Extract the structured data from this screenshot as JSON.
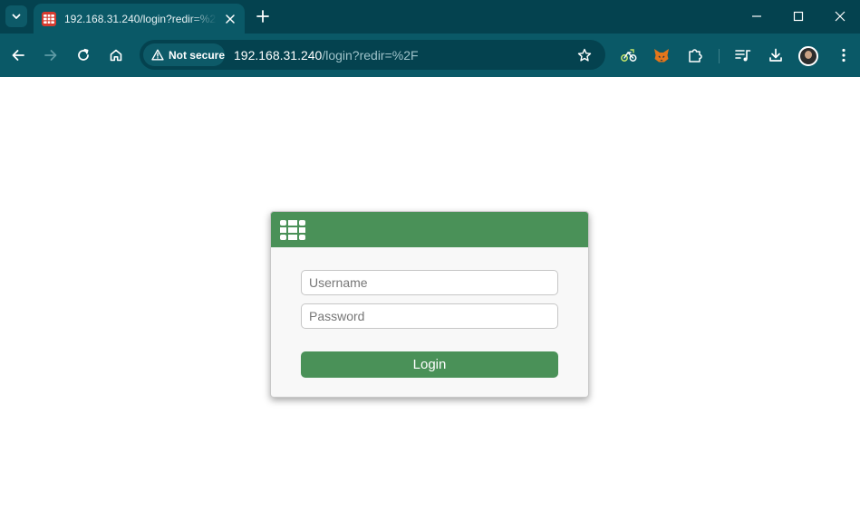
{
  "browser": {
    "tab": {
      "title": "192.168.31.240/login?redir=%2F",
      "favicon": "fortinet-favicon"
    },
    "address_bar": {
      "security_label": "Not secure",
      "url_host": "192.168.31.240",
      "url_path": "/login?redir=%2F"
    },
    "colors": {
      "frame": "#04424f",
      "toolbar": "#0a5967"
    }
  },
  "login": {
    "username_placeholder": "Username",
    "password_placeholder": "Password",
    "login_label": "Login",
    "brand_color": "#4a9158"
  }
}
